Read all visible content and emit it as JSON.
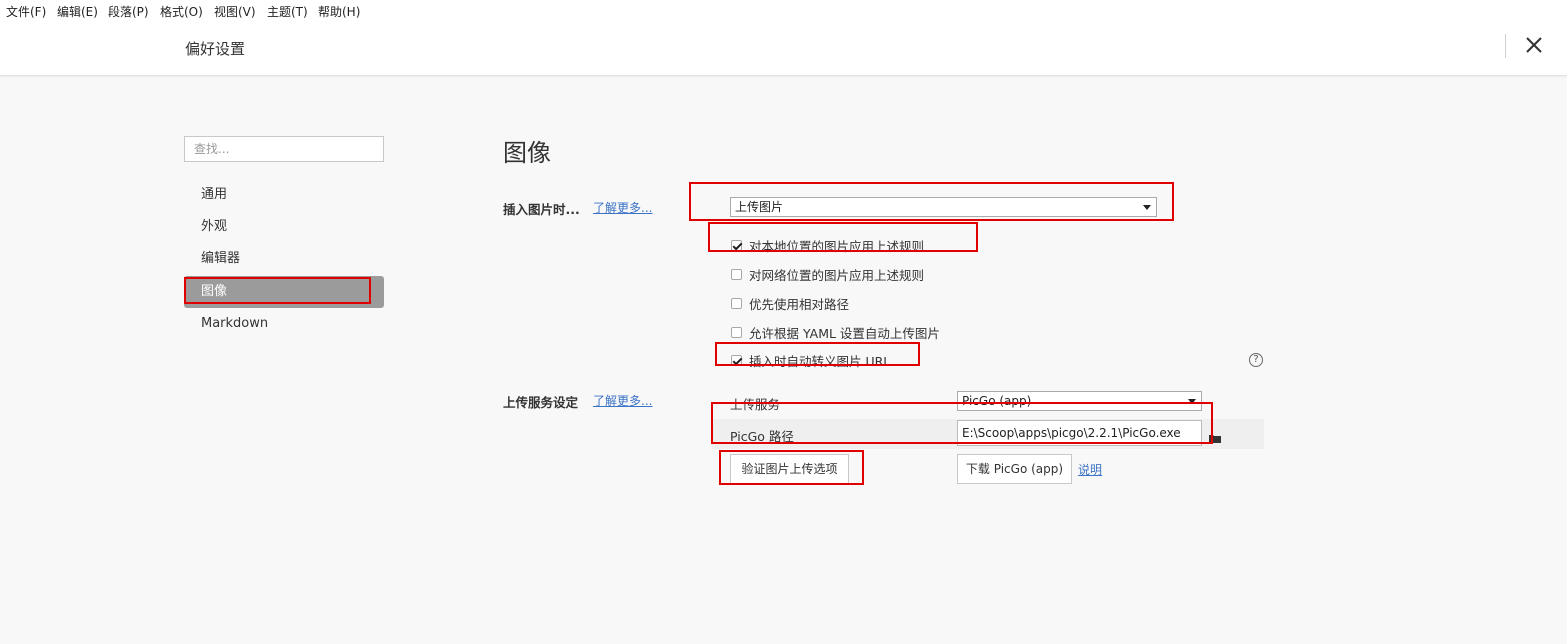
{
  "menubar": {
    "items": [
      "文件(F)",
      "编辑(E)",
      "段落(P)",
      "格式(O)",
      "视图(V)",
      "主题(T)",
      "帮助(H)"
    ]
  },
  "dialog": {
    "title": "偏好设置",
    "close_icon": "close-icon"
  },
  "sidebar": {
    "search_placeholder": "查找...",
    "items": [
      {
        "label": "通用",
        "active": false
      },
      {
        "label": "外观",
        "active": false
      },
      {
        "label": "编辑器",
        "active": false
      },
      {
        "label": "图像",
        "active": true
      },
      {
        "label": "Markdown",
        "active": false
      }
    ]
  },
  "main": {
    "section_title": "图像",
    "insert_image": {
      "label": "插入图片时...",
      "learn_more": "了解更多...",
      "action_value": "上传图片",
      "options": [
        {
          "label": "对本地位置的图片应用上述规则",
          "checked": true
        },
        {
          "label": "对网络位置的图片应用上述规则",
          "checked": false
        },
        {
          "label": "优先使用相对路径",
          "checked": false
        },
        {
          "label": "允许根据 YAML 设置自动上传图片",
          "checked": false
        },
        {
          "label": "插入时自动转义图片 URL",
          "checked": true
        }
      ],
      "help_icon": "?"
    },
    "upload_service": {
      "label": "上传服务设定",
      "learn_more": "了解更多...",
      "service_label": "上传服务",
      "service_value": "PicGo (app)",
      "path_label": "PicGo 路径",
      "path_value": "E:\\Scoop\\apps\\picgo\\2.2.1\\PicGo.exe",
      "folder_icon": "folder-icon",
      "verify_button": "验证图片上传选项",
      "download_button": "下载 PicGo (app)",
      "doc_link": "说明"
    }
  },
  "colors": {
    "annotation": "#e00000",
    "link": "#3b73c7",
    "active_nav": "#9b9b9b",
    "background": "#f8f8f8"
  }
}
